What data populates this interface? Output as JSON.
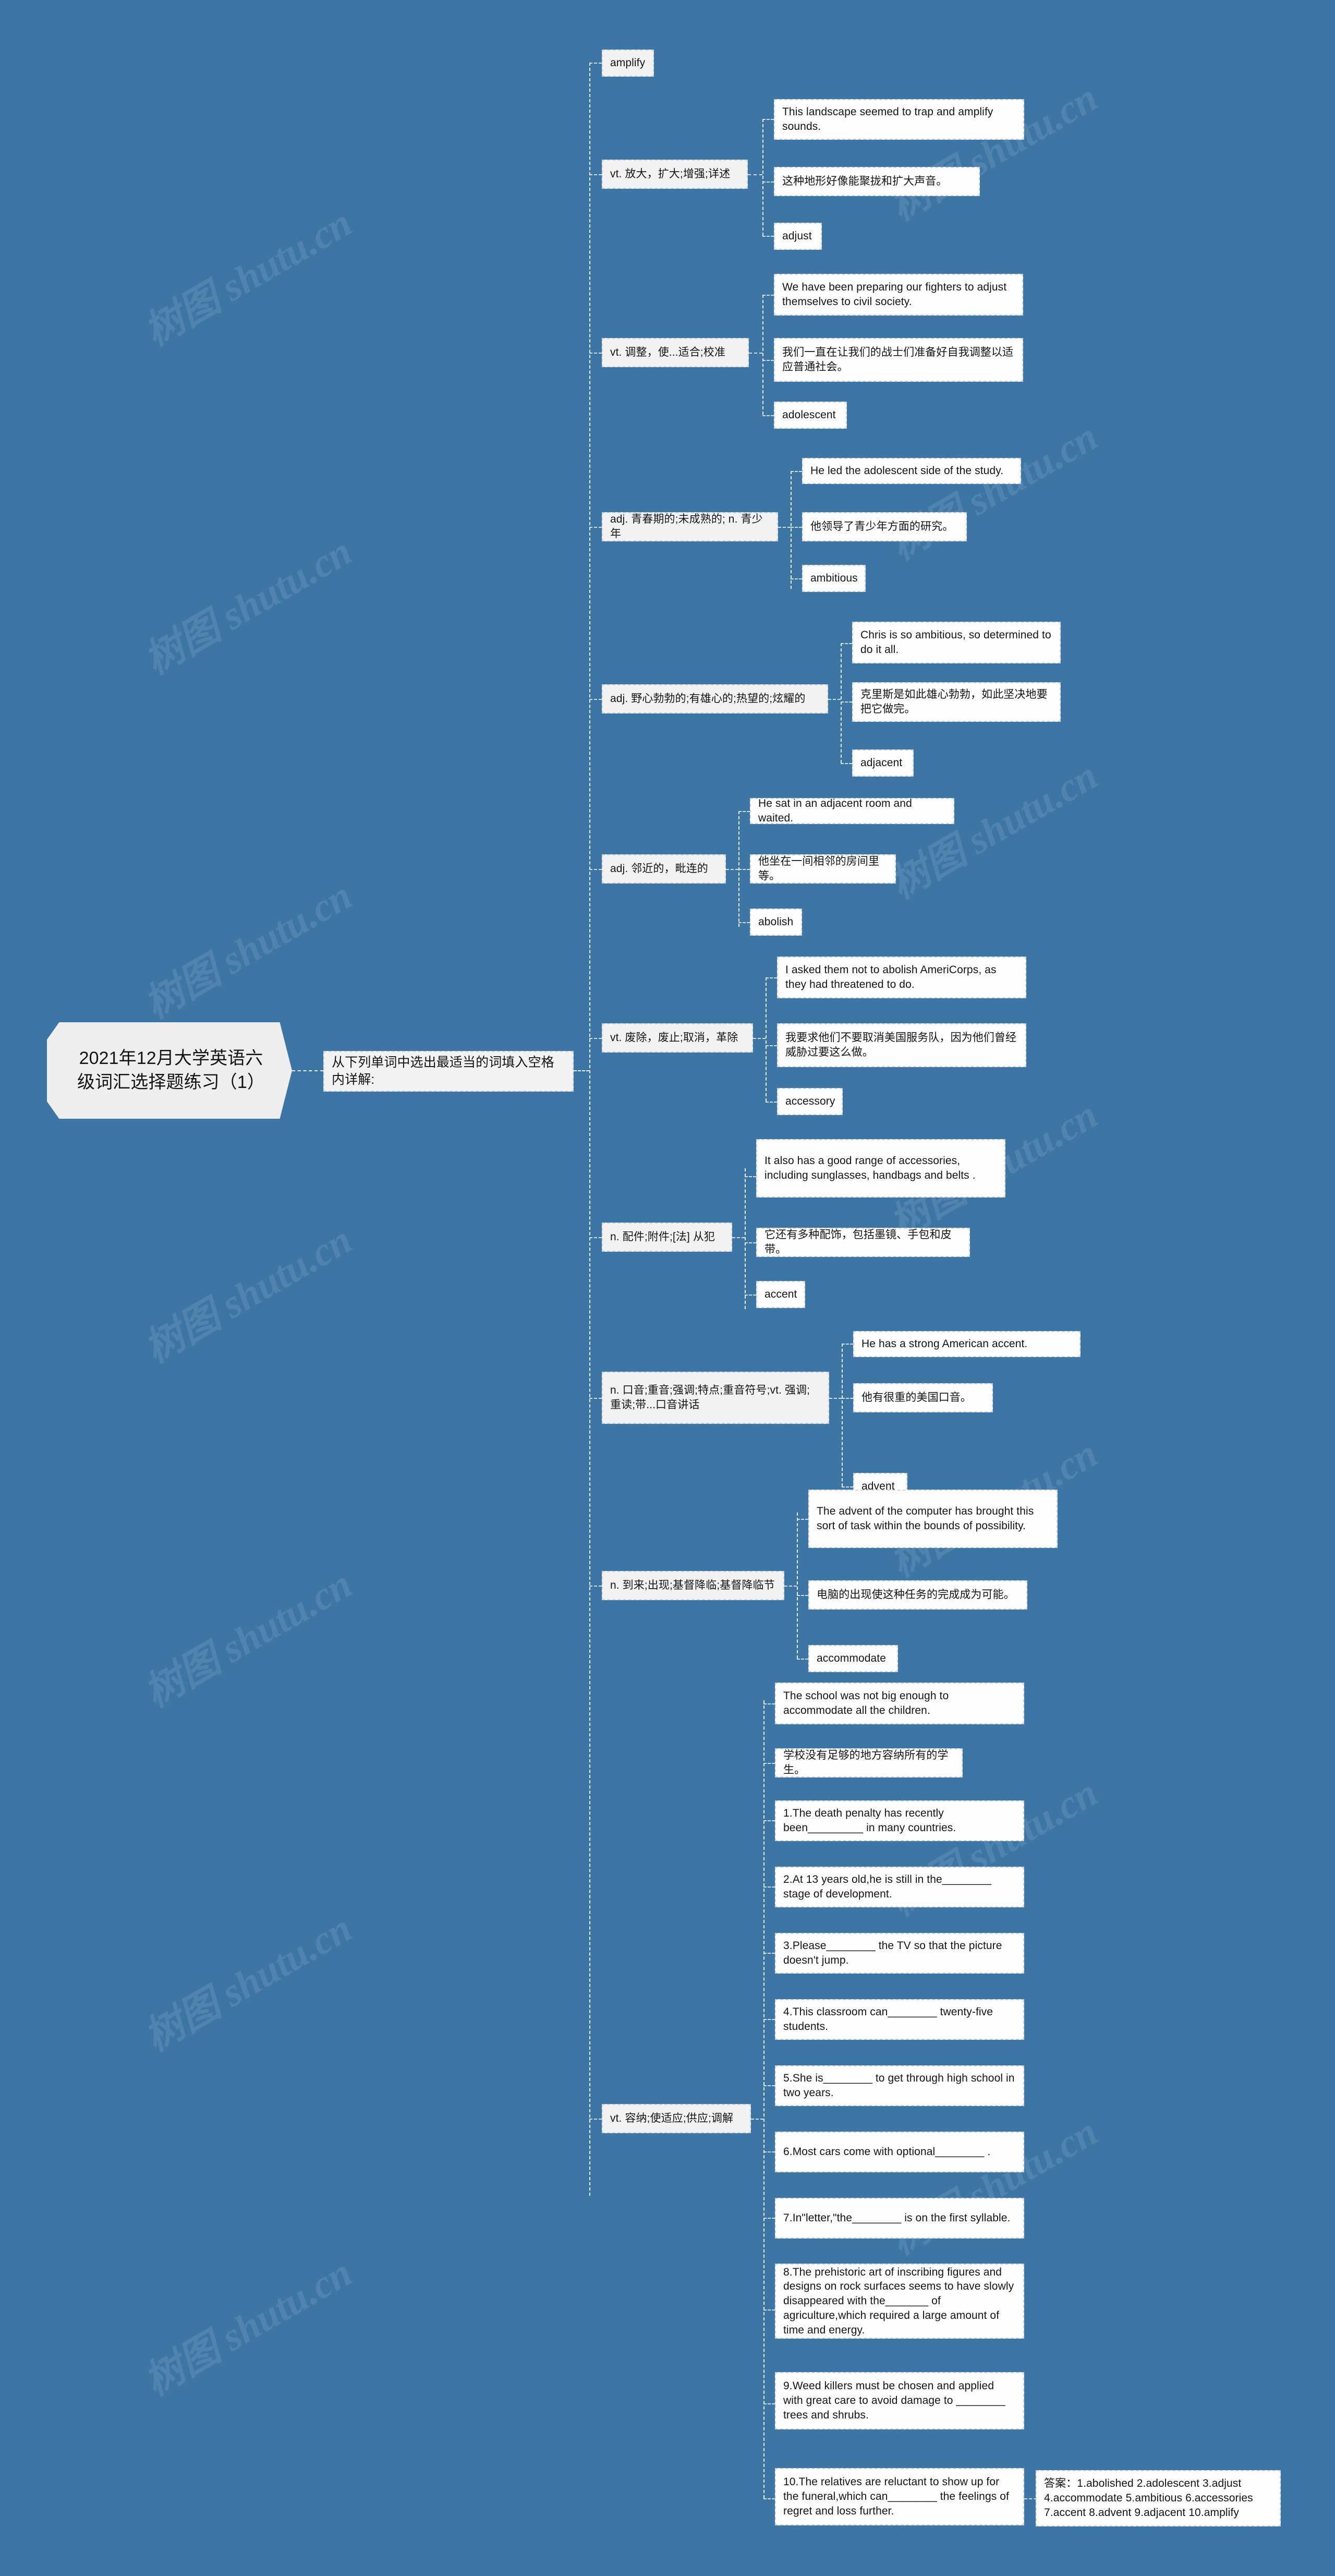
{
  "theme": {
    "background": "#3d76a5",
    "node_bg": "#f2f2f2",
    "node_border": "#c9d4dd",
    "line": "#ffffff",
    "text": "#141414"
  },
  "watermark": "树图 shutu.cn",
  "root": {
    "title": "2021年12月大学英语六级词汇选择题练习（1）"
  },
  "level2": {
    "label": "从下列单词中选出最适当的词填入空格内详解:"
  },
  "words": [
    {
      "word": "amplify",
      "definition": "vt. 放大，扩大;增强;详述",
      "example_en": "This landscape seemed to trap and amplify sounds.",
      "example_zh": "这种地形好像能聚拢和扩大声音。"
    },
    {
      "word": "adjust",
      "definition": "vt. 调整，使...适合;校准",
      "example_en": "We have been preparing our fighters to adjust themselves to civil society.",
      "example_zh": "我们一直在让我们的战士们准备好自我调整以适应普通社会。"
    },
    {
      "word": "adolescent",
      "definition": "adj. 青春期的;未成熟的; n. 青少年",
      "example_en": "He led the adolescent side of the study.",
      "example_zh": "他领导了青少年方面的研究。"
    },
    {
      "word": "ambitious",
      "definition": "adj. 野心勃勃的;有雄心的;热望的;炫耀的",
      "example_en": "Chris is so ambitious, so determined to do it all.",
      "example_zh": "克里斯是如此雄心勃勃，如此坚决地要把它做完。"
    },
    {
      "word": "adjacent",
      "definition": "adj. 邻近的，毗连的",
      "example_en": "He sat in an adjacent room and waited.",
      "example_zh": "他坐在一间相邻的房间里等。"
    },
    {
      "word": "abolish",
      "definition": "vt. 废除，废止;取消，革除",
      "example_en": "I asked them not to abolish AmeriCorps, as they had threatened to do.",
      "example_zh": "我要求他们不要取消美国服务队，因为他们曾经威胁过要这么做。"
    },
    {
      "word": "accessory",
      "definition": "n. 配件;附件;[法] 从犯",
      "example_en": "It also has a good range of accessories, including sunglasses, handbags and belts .",
      "example_zh": "它还有多种配饰，包括墨镜、手包和皮带。"
    },
    {
      "word": "accent",
      "definition": "n. 口音;重音;强调;特点;重音符号;vt. 强调;重读;带...口音讲话",
      "example_en": "He has a strong American accent.",
      "example_zh": "他有很重的美国口音。"
    },
    {
      "word": "advent",
      "definition": "n. 到来;出现;基督降临;基督降临节",
      "example_en": "The advent of the computer has brought this sort of task within the bounds of possibility.",
      "example_zh": "电脑的出现使这种任务的完成成为可能。"
    },
    {
      "word": "accommodate",
      "definition": "vt. 容纳;使适应;供应;调解",
      "example_en": "The school was not big enough to accommodate all the children.",
      "example_zh": "学校没有足够的地方容纳所有的学生。"
    }
  ],
  "questions": [
    "1.The death penalty has recently been_________ in many countries.",
    "2.At 13 years old,he is still in the________ stage of development.",
    "3.Please________ the TV so that the picture doesn't jump.",
    "4.This classroom can________ twenty-five students.",
    "5.She is________ to get through high school in two years.",
    "6.Most cars come with optional________ .",
    "7.In\"letter,\"the________ is on the first syllable.",
    "8.The prehistoric art of inscribing figures and designs on rock surfaces seems to have slowly disappeared with the_______ of agriculture,which required a large amount of time and energy.",
    "9.Weed killers must be chosen and applied with great care to avoid damage to ________ trees and shrubs.",
    "10.The relatives are reluctant to show up for the funeral,which can________ the feelings of regret and loss further."
  ],
  "answers": "答案：1.abolished 2.adolescent 3.adjust 4.accommodate 5.ambitious 6.accessories 7.accent 8.advent 9.adjacent 10.amplify"
}
